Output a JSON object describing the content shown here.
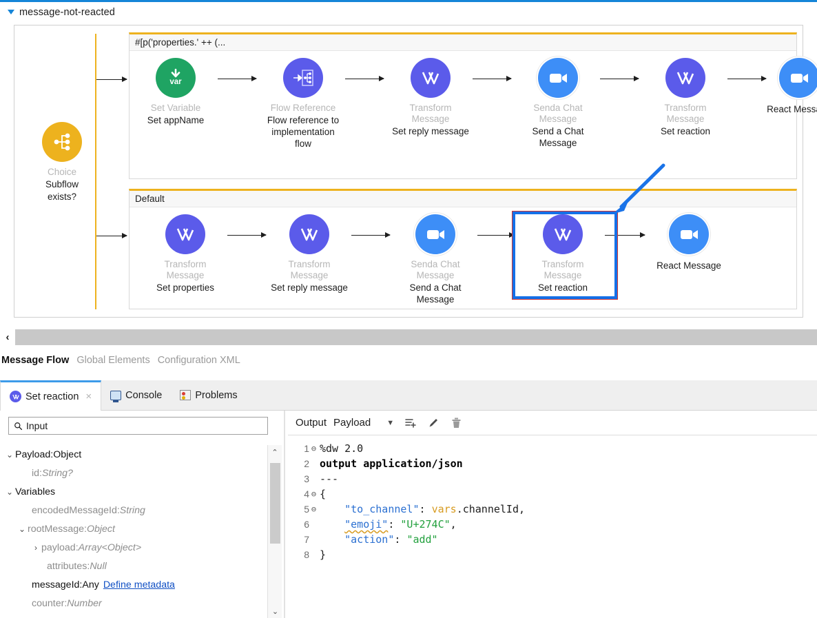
{
  "flow": {
    "title": "message-not-reacted",
    "expand_icon": "triangle-down-icon",
    "choice": {
      "type": "Choice",
      "label_line1": "Subflow",
      "label_line2": "exists?",
      "icon": "choice-icon",
      "color": "#edb21e"
    },
    "branches": [
      {
        "condition": "#[p('properties.' ++ (...",
        "nodes": [
          {
            "type": "Set Variable",
            "label": "Set appName",
            "icon": "set-variable-icon",
            "color": "#1fa463",
            "selected": false
          },
          {
            "type": "Flow Reference",
            "label": "Flow reference to implementation flow",
            "icon": "flow-reference-icon",
            "color": "#5b5bea",
            "selected": false
          },
          {
            "type": "Transform Message",
            "label": "Set reply message",
            "icon": "transform-message-icon",
            "color": "#5b5bea",
            "selected": false
          },
          {
            "type": "Senda Chat Message",
            "label": "Send a Chat Message",
            "icon": "video-camera-icon",
            "color": "#3d8ef7",
            "selected": false
          },
          {
            "type": "Transform Message",
            "label": "Set reaction",
            "icon": "transform-message-icon",
            "color": "#5b5bea",
            "selected": false
          },
          {
            "type": "",
            "label": "React Message",
            "icon": "video-camera-icon",
            "color": "#3d8ef7",
            "selected": false
          }
        ]
      },
      {
        "condition": "Default",
        "nodes": [
          {
            "type": "Transform Message",
            "label": "Set properties",
            "icon": "transform-message-icon",
            "color": "#5b5bea",
            "selected": false
          },
          {
            "type": "Transform Message",
            "label": "Set reply message",
            "icon": "transform-message-icon",
            "color": "#5b5bea",
            "selected": false
          },
          {
            "type": "Senda Chat Message",
            "label": "Send a Chat Message",
            "icon": "video-camera-icon",
            "color": "#3d8ef7",
            "selected": false
          },
          {
            "type": "Transform Message",
            "label": "Set reaction",
            "icon": "transform-message-icon",
            "color": "#5b5bea",
            "selected": true
          },
          {
            "type": "",
            "label": "React Message",
            "icon": "video-camera-icon",
            "color": "#3d8ef7",
            "selected": false
          }
        ]
      }
    ],
    "annotation": {
      "kind": "arrow-annotation",
      "color": "#1a73e8"
    }
  },
  "scroll": {
    "left_arrow": "‹"
  },
  "view_tabs": [
    {
      "label": "Message Flow",
      "active": true
    },
    {
      "label": "Global Elements",
      "active": false
    },
    {
      "label": "Configuration XML",
      "active": false
    }
  ],
  "editor_tabs": [
    {
      "label": "Set reaction",
      "icon": "transform-message-icon",
      "active": true,
      "closable": true,
      "close_glyph": "×"
    },
    {
      "label": "Console",
      "icon": "console-icon",
      "active": false,
      "closable": false,
      "close_glyph": ""
    },
    {
      "label": "Problems",
      "icon": "problems-icon",
      "active": false,
      "closable": false,
      "close_glyph": ""
    }
  ],
  "input_panel": {
    "search": {
      "placeholder": "Input",
      "value": "",
      "icon": "search-icon"
    },
    "scroll_up_glyph": "⌃",
    "scroll_down_glyph": "⌄",
    "tree": [
      {
        "indent": 0,
        "twisty": "⌄",
        "name": "Payload",
        "sep": " : ",
        "type": "Object",
        "style": "dark",
        "selected": false,
        "link": ""
      },
      {
        "indent": 1,
        "twisty": "",
        "name": "id",
        "sep": " : ",
        "type": "String?",
        "style": "gray",
        "selected": false,
        "link": ""
      },
      {
        "indent": 0,
        "twisty": "⌄",
        "name": "Variables",
        "sep": "",
        "type": "",
        "style": "dark",
        "selected": false,
        "link": ""
      },
      {
        "indent": 1,
        "twisty": "",
        "name": "encodedMessageId",
        "sep": " : ",
        "type": "String",
        "style": "gray",
        "selected": false,
        "link": ""
      },
      {
        "indent": 1,
        "twisty": "⌄",
        "name": "rootMessage",
        "sep": " : ",
        "type": "Object",
        "style": "gray",
        "selected": false,
        "link": ""
      },
      {
        "indent": 2,
        "twisty": "›",
        "name": "payload",
        "sep": " : ",
        "type": "Array<Object>",
        "style": "gray",
        "selected": false,
        "link": ""
      },
      {
        "indent": 2,
        "twisty": "",
        "name": "attributes",
        "sep": " : ",
        "type": "Null",
        "style": "gray",
        "selected": false,
        "link": ""
      },
      {
        "indent": 1,
        "twisty": "",
        "name": "messageId",
        "sep": " : ",
        "type": "Any",
        "style": "dark",
        "selected": true,
        "link": "Define metadata"
      },
      {
        "indent": 1,
        "twisty": "",
        "name": "counter",
        "sep": " : ",
        "type": "Number",
        "style": "gray",
        "selected": false,
        "link": ""
      }
    ]
  },
  "output_panel": {
    "title": "Output",
    "target": "Payload",
    "toolbar": [
      {
        "name": "dropdown-caret-icon",
        "glyph": "▼"
      },
      {
        "name": "add-list-icon",
        "glyph": ""
      },
      {
        "name": "edit-pencil-icon",
        "glyph": ""
      },
      {
        "name": "delete-trash-icon",
        "glyph": ""
      }
    ],
    "code_lines": [
      {
        "n": "1",
        "fold": "⊖",
        "tokens": [
          {
            "t": "%dw 2.0",
            "c": "k-dw"
          }
        ]
      },
      {
        "n": "2",
        "fold": "",
        "tokens": [
          {
            "t": "output application/json",
            "c": "k-bold"
          }
        ]
      },
      {
        "n": "3",
        "fold": "",
        "tokens": [
          {
            "t": "---",
            "c": "k-dw"
          }
        ]
      },
      {
        "n": "4",
        "fold": "⊖",
        "tokens": [
          {
            "t": "{",
            "c": "k-pun"
          }
        ]
      },
      {
        "n": "5",
        "fold": "⊖",
        "tokens": [
          {
            "t": "    ",
            "c": "k-pun"
          },
          {
            "t": "\"to_channel\"",
            "c": "k-key"
          },
          {
            "t": ": ",
            "c": "k-pun"
          },
          {
            "t": "vars",
            "c": "k-var"
          },
          {
            "t": ".channelId,",
            "c": "k-pun"
          }
        ]
      },
      {
        "n": "6",
        "fold": "",
        "tokens": [
          {
            "t": "    ",
            "c": "k-pun"
          },
          {
            "t": "\"emoji\"",
            "c": "k-key squig"
          },
          {
            "t": ": ",
            "c": "k-pun"
          },
          {
            "t": "\"U+274C\"",
            "c": "k-str"
          },
          {
            "t": ",",
            "c": "k-pun"
          }
        ]
      },
      {
        "n": "7",
        "fold": "",
        "tokens": [
          {
            "t": "    ",
            "c": "k-pun"
          },
          {
            "t": "\"action\"",
            "c": "k-key"
          },
          {
            "t": ": ",
            "c": "k-pun"
          },
          {
            "t": "\"add\"",
            "c": "k-str"
          }
        ]
      },
      {
        "n": "8",
        "fold": "",
        "tokens": [
          {
            "t": "}",
            "c": "k-pun"
          }
        ]
      }
    ]
  }
}
